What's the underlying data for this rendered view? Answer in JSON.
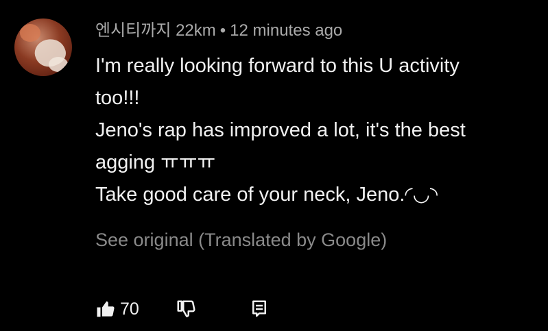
{
  "comment": {
    "author": "엔시티까지 22km",
    "separator": "•",
    "timestamp": "12 minutes ago",
    "lines": [
      "I'm really looking forward to this U activity",
      "too!!!",
      "Jeno's rap has improved a lot, it's the best",
      "agging ㅠㅠㅠ",
      "Take good care of your neck, Jeno.◜◡◝"
    ],
    "see_original": "See original (Translated by Google)",
    "like_count": "70"
  },
  "icons": {
    "like": "thumbs-up-icon",
    "dislike": "thumbs-down-icon",
    "reply": "reply-comment-icon"
  },
  "colors": {
    "background": "#000000",
    "text": "#f1f1f1",
    "meta": "#aaaaaa",
    "muted": "#8a8a8a"
  }
}
